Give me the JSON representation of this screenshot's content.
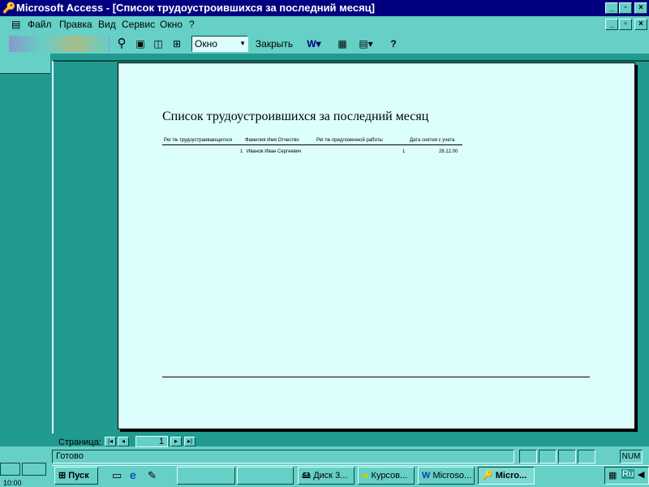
{
  "window": {
    "title": "Microsoft Access - [Список трудоустроившихся за последний месяц]"
  },
  "menu": [
    "Файл",
    "Правка",
    "Вид",
    "Сервис",
    "Окно",
    "?"
  ],
  "toolbar": {
    "zoom_select": "Окно",
    "close_label": "Закрыть"
  },
  "report": {
    "title": "Список трудоустроившихся за последний месяц",
    "columns": [
      "Рег № трудоустраивающегося",
      "Фамилия Имя Отчество",
      "Рег № предложенной работы",
      "Дата снятия с учета"
    ],
    "rows": [
      {
        "reg": "1",
        "name": "Иванов Иван Сергеевич",
        "job": "1",
        "date": "26.12.00"
      }
    ]
  },
  "pager": {
    "label": "Страница:",
    "page": "1"
  },
  "status": {
    "text": "Готово",
    "num": "NUM"
  },
  "taskbar": {
    "start": "Пуск",
    "tasks": [
      "Диск 3...",
      "Курсов...",
      "Microso...",
      "Micro..."
    ],
    "lang": "Ru"
  },
  "clock": "10:00"
}
